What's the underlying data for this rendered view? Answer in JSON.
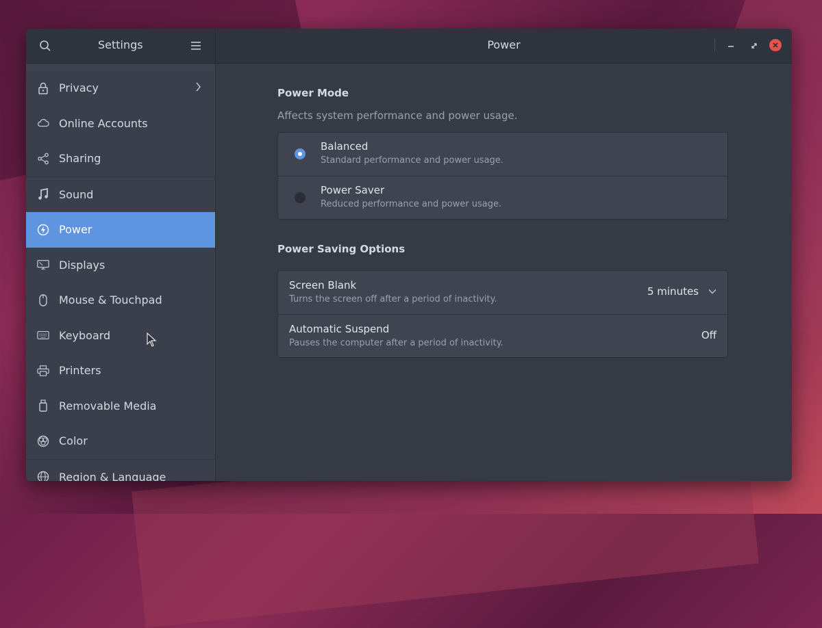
{
  "window": {
    "left_title": "Settings",
    "title": "Power"
  },
  "sidebar": {
    "items": [
      {
        "label": "Privacy",
        "icon": "lock-icon"
      },
      {
        "label": "Online Accounts",
        "icon": "cloud-icon"
      },
      {
        "label": "Sharing",
        "icon": "share-icon"
      },
      {
        "label": "Sound",
        "icon": "music-note-icon"
      },
      {
        "label": "Power",
        "icon": "power-icon"
      },
      {
        "label": "Displays",
        "icon": "display-icon"
      },
      {
        "label": "Mouse & Touchpad",
        "icon": "mouse-icon"
      },
      {
        "label": "Keyboard",
        "icon": "keyboard-icon"
      },
      {
        "label": "Printers",
        "icon": "printer-icon"
      },
      {
        "label": "Removable Media",
        "icon": "usb-drive-icon"
      },
      {
        "label": "Color",
        "icon": "color-icon"
      },
      {
        "label": "Region & Language",
        "icon": "globe-icon"
      }
    ],
    "active": "Power"
  },
  "power_mode": {
    "title": "Power Mode",
    "subtitle": "Affects system performance and power usage.",
    "options": [
      {
        "label": "Balanced",
        "desc": "Standard performance and power usage.",
        "selected": true
      },
      {
        "label": "Power Saver",
        "desc": "Reduced performance and power usage.",
        "selected": false
      }
    ]
  },
  "power_saving": {
    "title": "Power Saving Options",
    "rows": [
      {
        "label": "Screen Blank",
        "desc": "Turns the screen off after a period of inactivity.",
        "value": "5 minutes"
      },
      {
        "label": "Automatic Suspend",
        "desc": "Pauses the computer after a period of inactivity.",
        "value": "Off"
      }
    ]
  },
  "colors": {
    "accent": "#5f95e0",
    "close_button": "#e5534b",
    "window_bg": "#363a45"
  }
}
